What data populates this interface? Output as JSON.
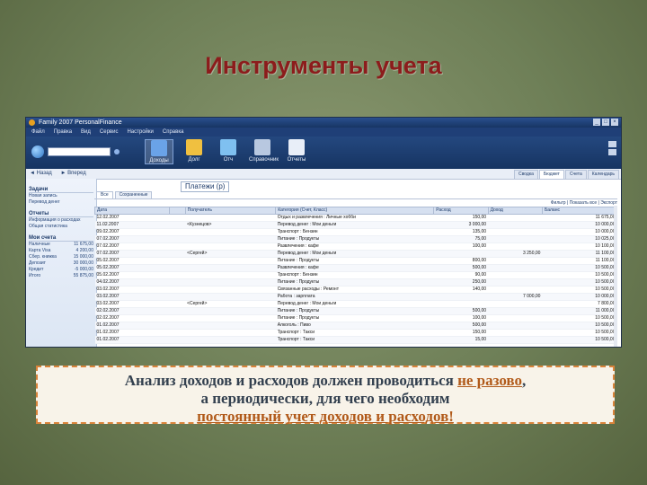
{
  "slide": {
    "title": "Инструменты учета",
    "note": {
      "line1_pre": "Анализ доходов и расходов должен проводиться ",
      "line1_link": "не разово",
      "line1_post": ",",
      "line2": "а периодически, для чего необходим",
      "line3_link": "постоянный учет доходов и расходов!"
    }
  },
  "app": {
    "title": "Family 2007 PersonalFinance",
    "menu": [
      "Файл",
      "Правка",
      "Вид",
      "Сервис",
      "Настройки",
      "Справка"
    ],
    "toolbar": {
      "tools": [
        {
          "label": "Доходы",
          "icon": "income-icon",
          "color": "#6aa3e8"
        },
        {
          "label": "Долг",
          "icon": "debt-icon",
          "color": "#f0c040"
        },
        {
          "label": "Отч",
          "icon": "folder-icon",
          "color": "#7fc0f0"
        },
        {
          "label": "Справочник",
          "icon": "people-icon",
          "color": "#b8c8e0"
        },
        {
          "label": "Отчеты",
          "icon": "report-icon",
          "color": "#e8eef8"
        }
      ]
    },
    "nav": {
      "back": "Назад",
      "forward": "Вперед",
      "right_tabs": [
        "Сводка",
        "Бюджет",
        "Счета",
        "Календарь"
      ]
    },
    "sidebar": {
      "sections": [
        {
          "header": "Задачи",
          "items": [
            "Новая запись",
            "Перевод денег"
          ]
        },
        {
          "header": "Отчеты",
          "items": [
            "Информация о расходах",
            "Общая статистика"
          ]
        }
      ],
      "accounts_header": "Мои счета",
      "accounts": [
        {
          "name": "Наличные",
          "value": "11 675,00"
        },
        {
          "name": "Карта Visa",
          "value": "4 200,00"
        },
        {
          "name": "Сбер. книжка",
          "value": "15 000,00"
        },
        {
          "name": "Депозит",
          "value": "30 000,00"
        },
        {
          "name": "Кредит",
          "value": "-5 000,00"
        },
        {
          "name": "Итого",
          "value": "55 875,00"
        }
      ]
    },
    "main": {
      "page_title": "Платежи (р)",
      "subtabs": [
        "Все",
        "Сохраненные"
      ],
      "filter": "Фильтр | Показать все | Экспорт",
      "columns": [
        "Дата",
        "",
        "Получатель",
        "Категория (Счет, Класс)",
        "Расход",
        "Доход",
        "Баланс"
      ],
      "rows": [
        [
          "12.02.2007",
          "",
          "",
          "Отдых и развлечения : Личные хобби",
          "150,00",
          "",
          "11 675,00"
        ],
        [
          "11.02.2007",
          "",
          "<Кузнецов>",
          "Перевод денег : Мои деньги",
          "3 000,00",
          "",
          "10 000,00"
        ],
        [
          "09.02.2007",
          "",
          "",
          "Транспорт : Бензин",
          "135,00",
          "",
          "10 000,00"
        ],
        [
          "07.02.2007",
          "",
          "",
          "Питание : Продукты",
          "75,00",
          "",
          "10 025,00"
        ],
        [
          "07.02.2007",
          "",
          "",
          "Развлечения : кафе",
          "100,00",
          "",
          "10 100,00"
        ],
        [
          "07.02.2007",
          "",
          "<Сергей>",
          "Перевод денег : Мои деньги",
          "",
          "3 250,00",
          "11 100,00"
        ],
        [
          "05.02.2007",
          "",
          "",
          "Питание : Продукты",
          "800,00",
          "",
          "11 100,00"
        ],
        [
          "05.02.2007",
          "",
          "",
          "Развлечения : кафе",
          "500,00",
          "",
          "10 500,00"
        ],
        [
          "05.02.2007",
          "",
          "",
          "Транспорт : Бензин",
          "90,00",
          "",
          "10 500,00"
        ],
        [
          "04.02.2007",
          "",
          "",
          "Питание : Продукты",
          "250,00",
          "",
          "10 500,00"
        ],
        [
          "03.02.2007",
          "",
          "",
          "Связанные расходы : Ремонт",
          "140,00",
          "",
          "10 500,00"
        ],
        [
          "03.02.2007",
          "",
          "",
          "Работа : зарплата",
          "",
          "7 000,00",
          "10 000,00"
        ],
        [
          "03.02.2007",
          "",
          "<Сергей>",
          "Перевод денег : Мои деньги",
          "",
          "",
          "7 800,00"
        ],
        [
          "02.02.2007",
          "",
          "",
          "Питание : Продукты",
          "500,00",
          "",
          "11 000,00"
        ],
        [
          "02.02.2007",
          "",
          "",
          "Питание : Продукты",
          "100,00",
          "",
          "10 500,00"
        ],
        [
          "01.02.2007",
          "",
          "",
          "Алкоголь : Пиво",
          "500,00",
          "",
          "10 500,00"
        ],
        [
          "01.02.2007",
          "",
          "",
          "Транспорт : Такси",
          "150,00",
          "",
          "10 500,00"
        ],
        [
          "01.02.2007",
          "",
          "",
          "Транспорт : Такси",
          "15,00",
          "",
          "10 500,00"
        ]
      ]
    }
  }
}
